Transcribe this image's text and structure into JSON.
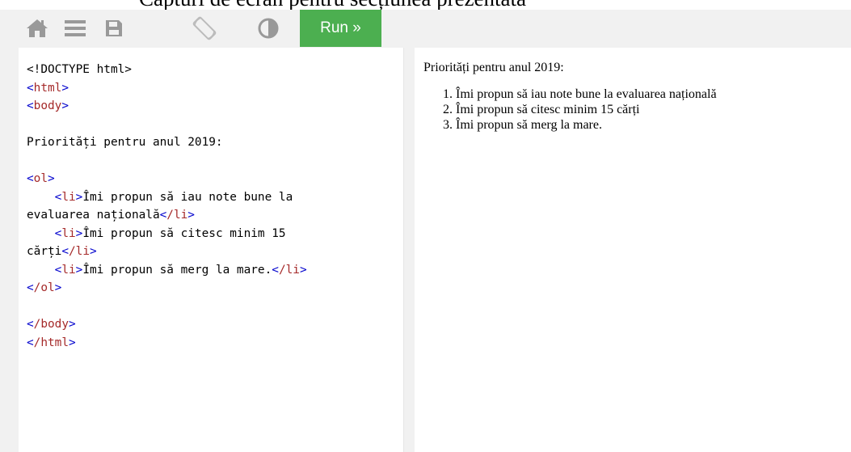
{
  "clipped_heading": "Capturi de ecran pentru secțiunea prezentată",
  "toolbar": {
    "icons": [
      "home-icon",
      "menu-icon",
      "save-icon",
      "rotate-icon",
      "contrast-icon"
    ],
    "run_label": "Run »"
  },
  "colors": {
    "run_button": "#4caf50",
    "toolbar_bg": "#f1f1f1",
    "icon": "#999999",
    "tag_bracket": "mediumblue",
    "tag_name": "brown"
  },
  "editor": {
    "doctype": "<!DOCTYPE html>",
    "html_open": "html",
    "body_open": "body",
    "text": "Priorități pentru anul 2019:",
    "ol_open": "ol",
    "li_tag": "li",
    "li_close": "/li",
    "items": [
      {
        "line1": "Îmi propun să iau note bune la",
        "line2": "evaluarea națională"
      },
      {
        "line1": "Îmi propun să citesc minim 15",
        "line2": "cărți"
      },
      {
        "line1": "Îmi propun să merg la mare."
      }
    ],
    "ol_close": "/ol",
    "body_close": "/body",
    "html_close": "/html"
  },
  "result": {
    "heading": "Priorități pentru anul 2019:",
    "items": [
      "Îmi propun să iau note bune la evaluarea națională",
      "Îmi propun să citesc minim 15 cărți",
      "Îmi propun să merg la mare."
    ]
  }
}
